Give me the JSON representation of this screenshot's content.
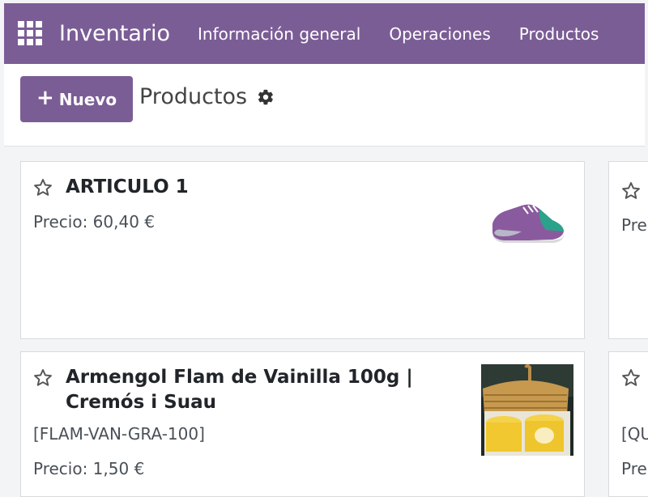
{
  "navbar": {
    "app_title": "Inventario",
    "menu": [
      "Información general",
      "Operaciones",
      "Productos"
    ]
  },
  "control_panel": {
    "new_button_label": "Nuevo",
    "breadcrumb": "Productos"
  },
  "cards": [
    {
      "name": "ARTICULO 1",
      "price": "Precio: 60,40 €",
      "image": "sneaker-icon"
    },
    {
      "name_line1": "Armengol Flam de Vainilla 100g |",
      "name_line2": "Cremós i Suau",
      "code": "[FLAM-VAN-GRA-100]",
      "price": "Precio: 1,50 €",
      "image": "flan-basket-photo"
    },
    {
      "price_partial": "Pre"
    },
    {
      "code_partial": "[QU",
      "price_partial": "Pre"
    }
  ],
  "colors": {
    "brand": "#7b5d96",
    "background": "#f3f4f6"
  }
}
